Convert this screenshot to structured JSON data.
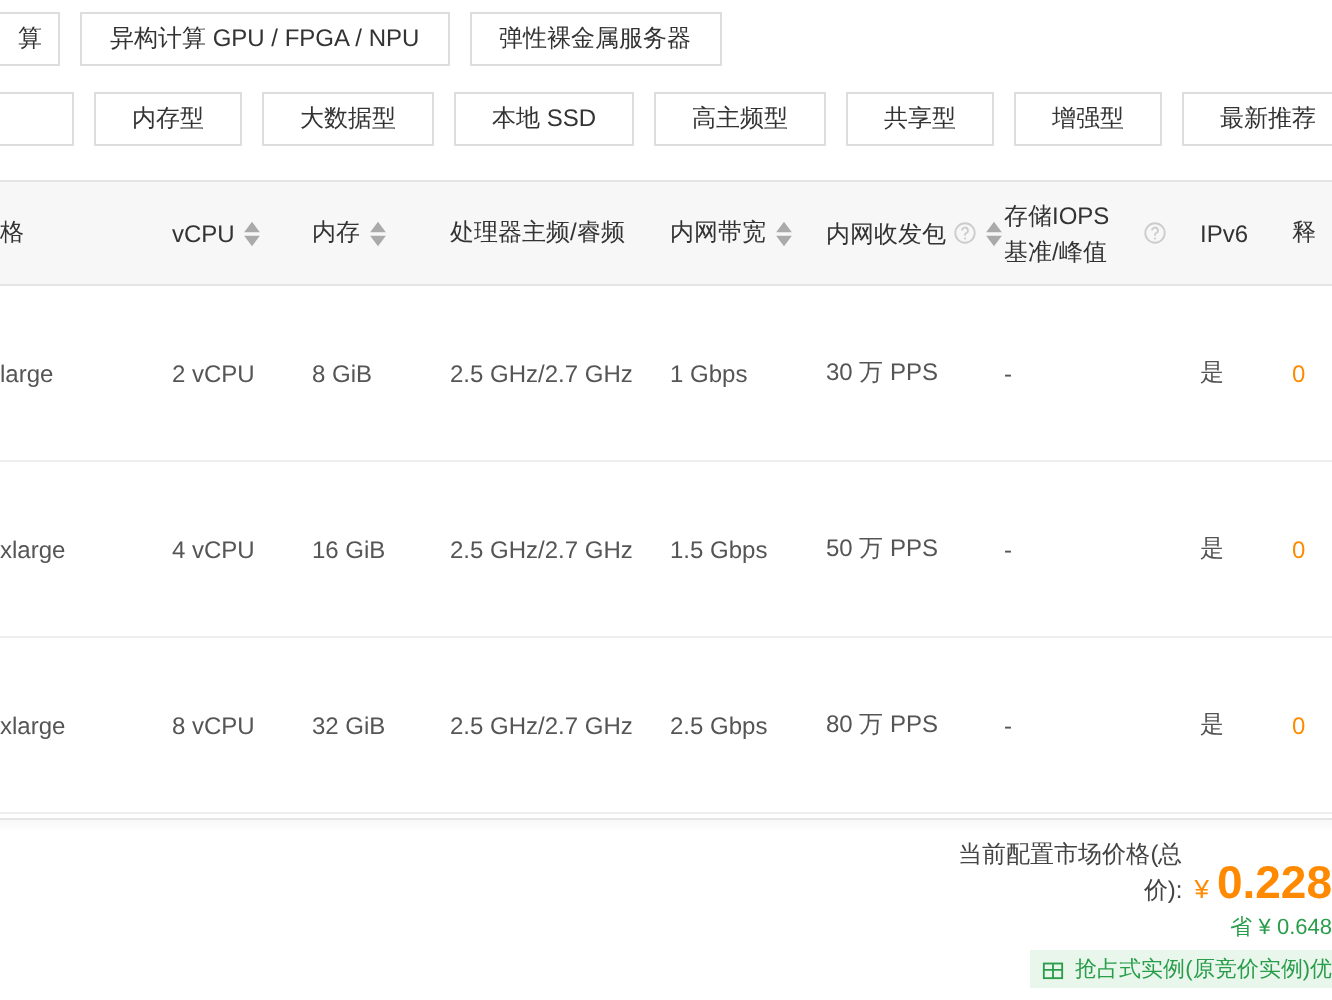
{
  "category_tabs": [
    {
      "label": "算",
      "selected": false
    },
    {
      "label": "异构计算 GPU / FPGA / NPU",
      "selected": false
    },
    {
      "label": "弹性裸金属服务器",
      "selected": false
    }
  ],
  "type_tabs": [
    {
      "label": "内存型",
      "selected": false
    },
    {
      "label": "大数据型",
      "selected": false
    },
    {
      "label": "本地 SSD",
      "selected": false
    },
    {
      "label": "高主频型",
      "selected": false
    },
    {
      "label": "共享型",
      "selected": false
    },
    {
      "label": "增强型",
      "selected": false
    },
    {
      "label": "最新推荐",
      "selected": false
    }
  ],
  "table": {
    "columns": [
      {
        "label": "格",
        "sortable": false,
        "help": false
      },
      {
        "label": "vCPU",
        "sortable": true,
        "help": false
      },
      {
        "label": "内存",
        "sortable": true,
        "help": false
      },
      {
        "label": "处理器主频/睿频",
        "sortable": false,
        "help": false
      },
      {
        "label": "内网带宽",
        "sortable": true,
        "help": false
      },
      {
        "label": "内网收发包",
        "sortable": true,
        "help": true
      },
      {
        "label": "存储IOPS 基准/峰值",
        "sortable": false,
        "help": true
      },
      {
        "label": "IPv6",
        "sortable": false,
        "help": false
      },
      {
        "label": "释",
        "sortable": false,
        "help": false
      }
    ],
    "rows": [
      [
        "large",
        "2 vCPU",
        "8 GiB",
        "2.5 GHz/2.7 GHz",
        "1 Gbps",
        "30 万 PPS",
        "-",
        "是",
        "0"
      ],
      [
        "xlarge",
        "4 vCPU",
        "16 GiB",
        "2.5 GHz/2.7 GHz",
        "1.5 Gbps",
        "50 万 PPS",
        "-",
        "是",
        "0"
      ],
      [
        "xlarge",
        "8 vCPU",
        "32 GiB",
        "2.5 GHz/2.7 GHz",
        "2.5 Gbps",
        "80 万 PPS",
        "-",
        "是",
        "0"
      ]
    ]
  },
  "price": {
    "label": "当前配置市场价格(总价):",
    "currency": "¥",
    "amount": "0.228",
    "savings": "省 ¥ 0.648",
    "promo": "抢占式实例(原竞价实例)优"
  }
}
